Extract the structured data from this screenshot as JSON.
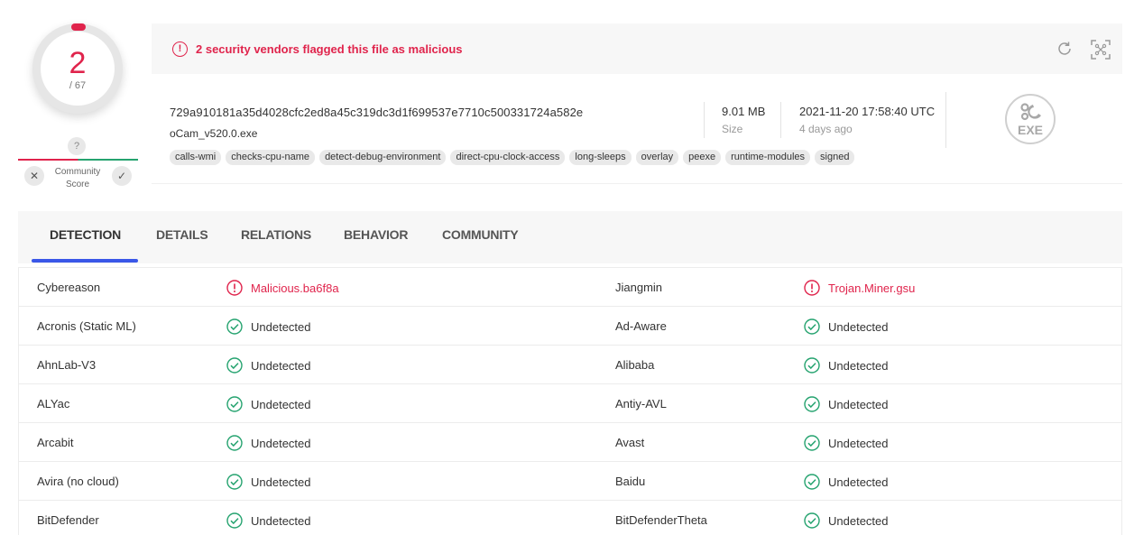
{
  "score": {
    "detections": "2",
    "total": "/ 67",
    "accent_color": "#e0244c"
  },
  "community": {
    "unknown_symbol": "?",
    "label_line1": "Community",
    "label_line2": "Score",
    "vote_down_icon": "close-icon",
    "vote_up_icon": "check-icon"
  },
  "alert": {
    "icon": "alert-circle-icon",
    "text": "2 security vendors flagged this file as malicious",
    "actions": [
      "refresh-icon",
      "scan-similar-icon"
    ]
  },
  "file": {
    "hash": "729a910181a35d4028cfc2ed8a45c319dc3d1f699537e7710c500331724a582e",
    "name": "oCam_v520.0.exe",
    "tags": [
      "calls-wmi",
      "checks-cpu-name",
      "detect-debug-environment",
      "direct-cpu-clock-access",
      "long-sleeps",
      "overlay",
      "peexe",
      "runtime-modules",
      "signed"
    ],
    "size_value": "9.01 MB",
    "size_label": "Size",
    "date_value": "2021-11-20 17:58:40 UTC",
    "date_label": "4 days ago",
    "type_badge": "EXE"
  },
  "tabs": [
    {
      "label": "DETECTION",
      "active": true
    },
    {
      "label": "DETAILS",
      "active": false
    },
    {
      "label": "RELATIONS",
      "active": false
    },
    {
      "label": "BEHAVIOR",
      "active": false
    },
    {
      "label": "COMMUNITY",
      "active": false
    }
  ],
  "detections": [
    {
      "left": {
        "engine": "Cybereason",
        "result": "Malicious.ba6f8a",
        "status": "malicious"
      },
      "right": {
        "engine": "Jiangmin",
        "result": "Trojan.Miner.gsu",
        "status": "malicious"
      }
    },
    {
      "left": {
        "engine": "Acronis (Static ML)",
        "result": "Undetected",
        "status": "undetected"
      },
      "right": {
        "engine": "Ad-Aware",
        "result": "Undetected",
        "status": "undetected"
      }
    },
    {
      "left": {
        "engine": "AhnLab-V3",
        "result": "Undetected",
        "status": "undetected"
      },
      "right": {
        "engine": "Alibaba",
        "result": "Undetected",
        "status": "undetected"
      }
    },
    {
      "left": {
        "engine": "ALYac",
        "result": "Undetected",
        "status": "undetected"
      },
      "right": {
        "engine": "Antiy-AVL",
        "result": "Undetected",
        "status": "undetected"
      }
    },
    {
      "left": {
        "engine": "Arcabit",
        "result": "Undetected",
        "status": "undetected"
      },
      "right": {
        "engine": "Avast",
        "result": "Undetected",
        "status": "undetected"
      }
    },
    {
      "left": {
        "engine": "Avira (no cloud)",
        "result": "Undetected",
        "status": "undetected"
      },
      "right": {
        "engine": "Baidu",
        "result": "Undetected",
        "status": "undetected"
      }
    },
    {
      "left": {
        "engine": "BitDefender",
        "result": "Undetected",
        "status": "undetected"
      },
      "right": {
        "engine": "BitDefenderTheta",
        "result": "Undetected",
        "status": "undetected"
      }
    }
  ],
  "colors": {
    "malicious": "#e0244c",
    "undetected": "#25a36f",
    "tab_active": "#3a57e8"
  }
}
